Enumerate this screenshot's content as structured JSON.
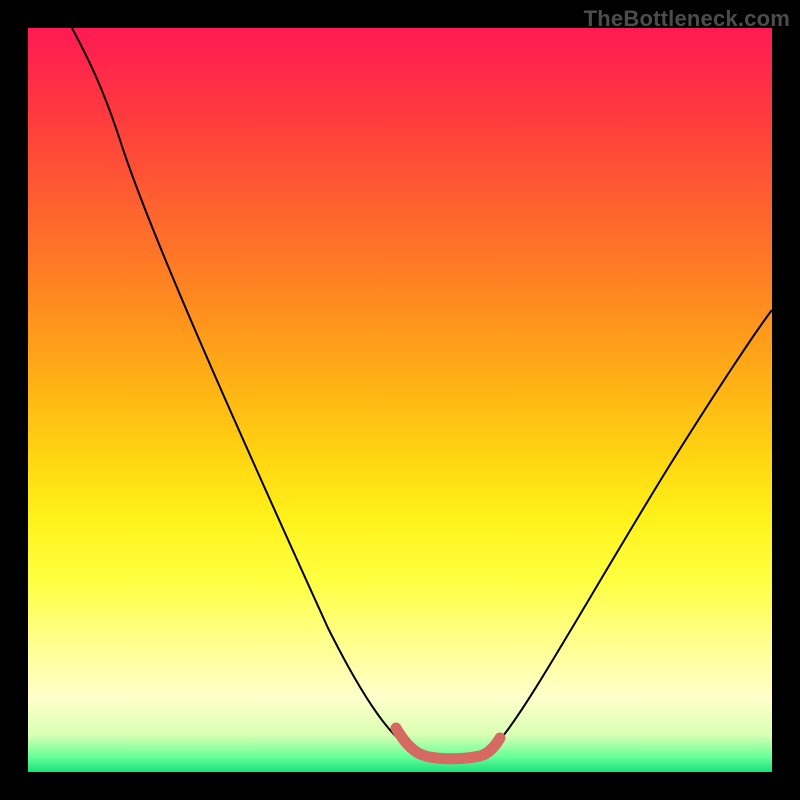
{
  "watermark": "TheBottleneck.com",
  "chart_data": {
    "type": "line",
    "title": "",
    "xlabel": "",
    "ylabel": "",
    "xlim": [
      0,
      100
    ],
    "ylim": [
      0,
      100
    ],
    "grid": false,
    "legend": false,
    "annotations": [],
    "background_gradient_stops": [
      {
        "pos": 0.0,
        "color": "#ff1a53"
      },
      {
        "pos": 0.12,
        "color": "#ff3b3e"
      },
      {
        "pos": 0.25,
        "color": "#ff652e"
      },
      {
        "pos": 0.37,
        "color": "#ff8b1f"
      },
      {
        "pos": 0.48,
        "color": "#ffb215"
      },
      {
        "pos": 0.58,
        "color": "#ffd611"
      },
      {
        "pos": 0.66,
        "color": "#fff21a"
      },
      {
        "pos": 0.74,
        "color": "#ffff40"
      },
      {
        "pos": 0.82,
        "color": "#ffff88"
      },
      {
        "pos": 0.9,
        "color": "#ffffcc"
      },
      {
        "pos": 0.95,
        "color": "#d9ffb3"
      },
      {
        "pos": 0.98,
        "color": "#66ff99"
      },
      {
        "pos": 1.0,
        "color": "#18e07a"
      }
    ],
    "series": [
      {
        "name": "bottleneck-curve-black",
        "stroke": "#000000",
        "stroke_width": 2,
        "points": [
          {
            "x": 6.0,
            "y": 100.0
          },
          {
            "x": 9.0,
            "y": 95.0
          },
          {
            "x": 12.0,
            "y": 89.0
          },
          {
            "x": 16.0,
            "y": 80.0
          },
          {
            "x": 22.0,
            "y": 67.0
          },
          {
            "x": 28.0,
            "y": 53.5
          },
          {
            "x": 34.0,
            "y": 40.0
          },
          {
            "x": 40.0,
            "y": 26.5
          },
          {
            "x": 46.0,
            "y": 13.5
          },
          {
            "x": 49.5,
            "y": 6.0
          },
          {
            "x": 52.0,
            "y": 2.5
          },
          {
            "x": 55.0,
            "y": 1.8
          },
          {
            "x": 58.0,
            "y": 1.8
          },
          {
            "x": 61.0,
            "y": 2.3
          },
          {
            "x": 63.5,
            "y": 5.0
          },
          {
            "x": 67.0,
            "y": 11.0
          },
          {
            "x": 73.0,
            "y": 22.0
          },
          {
            "x": 80.0,
            "y": 33.5
          },
          {
            "x": 88.0,
            "y": 45.5
          },
          {
            "x": 96.0,
            "y": 57.0
          },
          {
            "x": 100.0,
            "y": 62.0
          }
        ]
      },
      {
        "name": "bottleneck-valley-highlight",
        "stroke": "#d66a63",
        "stroke_width": 10,
        "points": [
          {
            "x": 49.5,
            "y": 6.0
          },
          {
            "x": 51.0,
            "y": 3.5
          },
          {
            "x": 53.0,
            "y": 2.0
          },
          {
            "x": 55.0,
            "y": 1.8
          },
          {
            "x": 57.0,
            "y": 1.8
          },
          {
            "x": 59.0,
            "y": 1.9
          },
          {
            "x": 61.0,
            "y": 2.3
          },
          {
            "x": 62.5,
            "y": 3.5
          },
          {
            "x": 63.5,
            "y": 5.0
          }
        ]
      }
    ]
  }
}
